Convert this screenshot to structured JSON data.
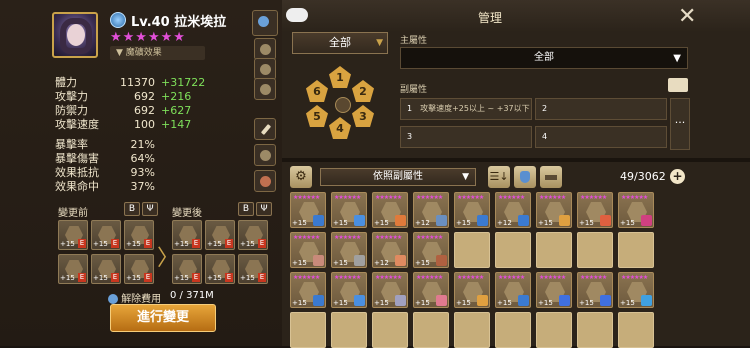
{
  "monster": {
    "level_name": "Lv.40 拉米埃拉",
    "stars": "★★★★★★",
    "awaken_label": "魔礦效果"
  },
  "stats": [
    {
      "label": "體力",
      "value": "11370",
      "bonus": "+31722"
    },
    {
      "label": "攻擊力",
      "value": "692",
      "bonus": "+216"
    },
    {
      "label": "防禦力",
      "value": "692",
      "bonus": "+627"
    },
    {
      "label": "攻擊速度",
      "value": "100",
      "bonus": "+147"
    },
    {
      "label": "暴擊率",
      "value": "21%",
      "bonus": ""
    },
    {
      "label": "暴擊傷害",
      "value": "64%",
      "bonus": ""
    },
    {
      "label": "效果抵抗",
      "value": "93%",
      "bonus": ""
    },
    {
      "label": "效果命中",
      "value": "37%",
      "bonus": ""
    }
  ],
  "change": {
    "before_label": "變更前",
    "after_label": "變更後",
    "cost_label": "解除費用",
    "cost_value": "0 / 371M",
    "apply_label": "進行變更",
    "rune_level": "+15",
    "rune_tag": "E",
    "btn_b": "B",
    "btn_v": "Ψ"
  },
  "header": {
    "title": "管理",
    "close": "✕"
  },
  "filters": {
    "set_filter": "全部",
    "main_stat_label": "主屬性",
    "main_stat_value": "全部",
    "sub_stat_label": "副屬性",
    "sub_slots": [
      {
        "num": "1",
        "text": "攻擊速度+25以上 ~ +37以下"
      },
      {
        "num": "2",
        "text": ""
      },
      {
        "num": "3",
        "text": ""
      },
      {
        "num": "4",
        "text": ""
      }
    ],
    "more_label": "···",
    "caret": "▼"
  },
  "slot_pad": [
    "1",
    "2",
    "3",
    "4",
    "5",
    "6"
  ],
  "toolbar": {
    "settings_icon": "⚙",
    "sort_label": "依照副屬性",
    "sort_order_icon": "☰↓",
    "count": "49/3062",
    "add": "+"
  },
  "inventory_rows": [
    [
      {
        "lv": "+15",
        "c": "#3b7ad0"
      },
      {
        "lv": "+15",
        "c": "#4a8fe0"
      },
      {
        "lv": "+15",
        "c": "#e07a3b"
      },
      {
        "lv": "+12",
        "c": "#6a8fc0"
      },
      {
        "lv": "+15",
        "c": "#3b7ad0"
      },
      {
        "lv": "+12",
        "c": "#3b7ad0"
      },
      {
        "lv": "+15",
        "c": "#e0a040"
      },
      {
        "lv": "+15",
        "c": "#e06040"
      },
      {
        "lv": "+15",
        "c": "#d04080"
      }
    ],
    [
      {
        "lv": "+15",
        "c": "#c98a7a"
      },
      {
        "lv": "+15",
        "c": "#a0a0a0"
      },
      {
        "lv": "+12",
        "c": "#e08a60"
      },
      {
        "lv": "+15",
        "c": "#b06040"
      }
    ],
    [
      {
        "lv": "+15",
        "c": "#3b7ad0"
      },
      {
        "lv": "+15",
        "c": "#4a8fe0"
      },
      {
        "lv": "+15",
        "c": "#a0a0c0"
      },
      {
        "lv": "+15",
        "c": "#e07a90"
      },
      {
        "lv": "+15",
        "c": "#e0a040"
      },
      {
        "lv": "+15",
        "c": "#3b7ad0"
      },
      {
        "lv": "+15",
        "c": "#4070e0"
      },
      {
        "lv": "+15",
        "c": "#4070e0"
      },
      {
        "lv": "+15",
        "c": "#40a0e0"
      }
    ]
  ]
}
